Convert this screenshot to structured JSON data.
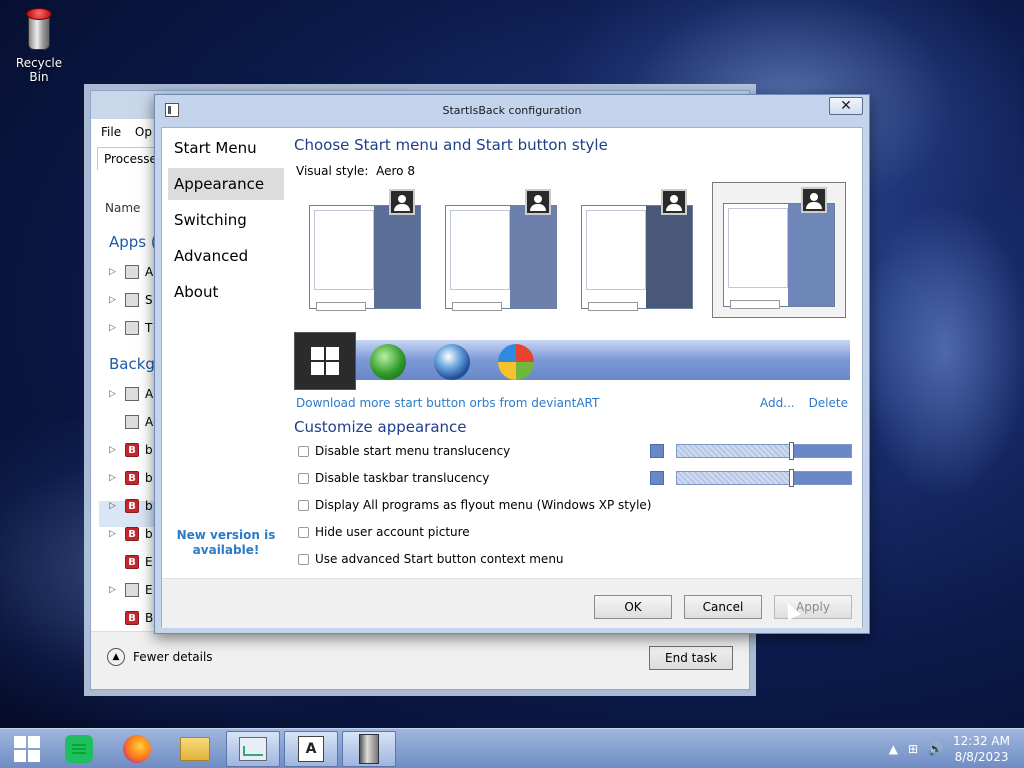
{
  "desktop": {
    "recycle_bin_label": "Recycle Bin"
  },
  "task_manager": {
    "menu": [
      "File",
      "Op"
    ],
    "tab_processes": "Processes",
    "column_name": "Name",
    "group_apps": "Apps (",
    "group_background": "Backgr",
    "rows": [
      "A",
      "S",
      "T",
      "A",
      "A",
      "b",
      "b",
      "b",
      "b",
      "E",
      "E",
      "B"
    ],
    "fewer_details": "Fewer details",
    "end_task": "End task"
  },
  "dialog": {
    "title": "StartIsBack configuration",
    "nav": [
      "Start Menu",
      "Appearance",
      "Switching",
      "Advanced",
      "About"
    ],
    "nav_selected": "Appearance",
    "new_version": "New version is available!",
    "heading_style": "Choose Start menu and Start button style",
    "visual_style_label": "Visual style:",
    "visual_style_value": "Aero 8",
    "download_orbs": "Download more start button orbs from deviantART",
    "add": "Add...",
    "delete": "Delete",
    "heading_customize": "Customize appearance",
    "options": [
      "Disable start menu translucency",
      "Disable taskbar translucency",
      "Display All programs as flyout menu (Windows XP style)",
      "Hide user account picture",
      "Use advanced Start button context menu"
    ],
    "ok": "OK",
    "cancel": "Cancel",
    "apply": "Apply"
  },
  "taskbar": {
    "items": [
      "start-button",
      "spreadsheet-app",
      "firefox",
      "file-explorer",
      "resource-monitor",
      "adobe-app",
      "startisback-config"
    ],
    "clock_time": "12:32 AM",
    "clock_date": "8/8/2023"
  },
  "colors": {
    "accent": "#6a88c8",
    "heading": "#1e3f8a",
    "link": "#2a7bc9"
  }
}
